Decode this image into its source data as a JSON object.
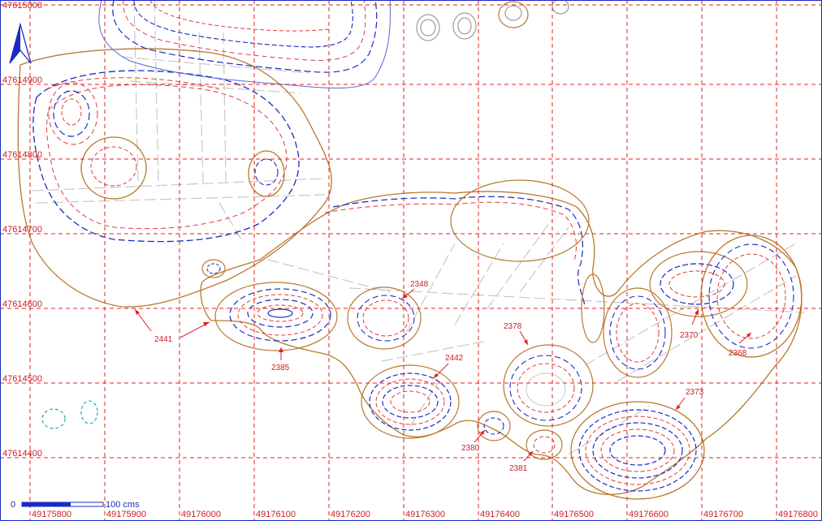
{
  "map": {
    "colors": {
      "grid": "#e02020",
      "outline": "#b8782f",
      "blue": "#1a2bbf",
      "red_dash": "#e03a3a",
      "grey": "#c8c8c8",
      "teal": "#2aa7b5",
      "label": "#cc1f1f"
    },
    "north_arrow": "north-arrow-icon",
    "y_labels": [
      "47615000",
      "47614900",
      "47614800",
      "47614700",
      "47614600",
      "47614500",
      "47614400"
    ],
    "x_labels": [
      "49175800",
      "49175900",
      "49176000",
      "49176100",
      "49176200",
      "49176300",
      "49176400",
      "49176500",
      "49176600",
      "49176700",
      "49176800"
    ],
    "features": [
      {
        "id": "2441",
        "label": "2441"
      },
      {
        "id": "2385",
        "label": "2385"
      },
      {
        "id": "2348",
        "label": "2348"
      },
      {
        "id": "2442",
        "label": "2442"
      },
      {
        "id": "2378",
        "label": "2378"
      },
      {
        "id": "2380",
        "label": "2380"
      },
      {
        "id": "2381",
        "label": "2381"
      },
      {
        "id": "2370",
        "label": "2370"
      },
      {
        "id": "2368",
        "label": "2368"
      },
      {
        "id": "2373",
        "label": "2373"
      }
    ],
    "scale": {
      "start": "0",
      "end": "100 cms"
    }
  }
}
